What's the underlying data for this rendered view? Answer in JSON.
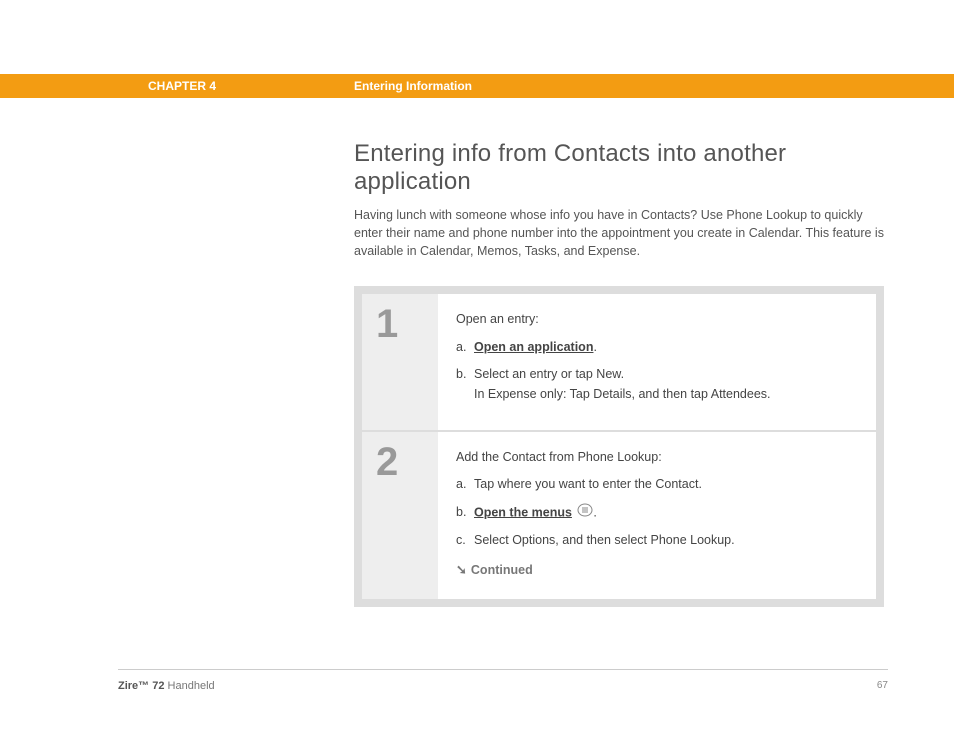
{
  "header": {
    "chapter": "CHAPTER 4",
    "section": "Entering Information"
  },
  "heading": "Entering info from Contacts into another application",
  "intro": "Having lunch with someone whose info you have in Contacts? Use Phone Lookup to quickly enter their name and phone number into the appointment you create in Calendar. This feature is available in Calendar, Memos, Tasks, and Expense.",
  "steps": [
    {
      "num": "1",
      "intro": "Open an entry:",
      "items": [
        {
          "letter": "a.",
          "link": "Open an application",
          "after": "."
        },
        {
          "letter": "b.",
          "text": "Select an entry or tap New.",
          "line2": "In Expense only: Tap Details, and then tap Attendees."
        }
      ]
    },
    {
      "num": "2",
      "intro": "Add the Contact from Phone Lookup:",
      "items": [
        {
          "letter": "a.",
          "text": "Tap where you want to enter the Contact."
        },
        {
          "letter": "b.",
          "link": "Open the menus",
          "icon": true,
          "after": "."
        },
        {
          "letter": "c.",
          "text": "Select Options, and then select Phone Lookup."
        }
      ],
      "continued": "Continued"
    }
  ],
  "footer": {
    "product": "Zire™ 72",
    "type": "Handheld",
    "page": "67"
  }
}
